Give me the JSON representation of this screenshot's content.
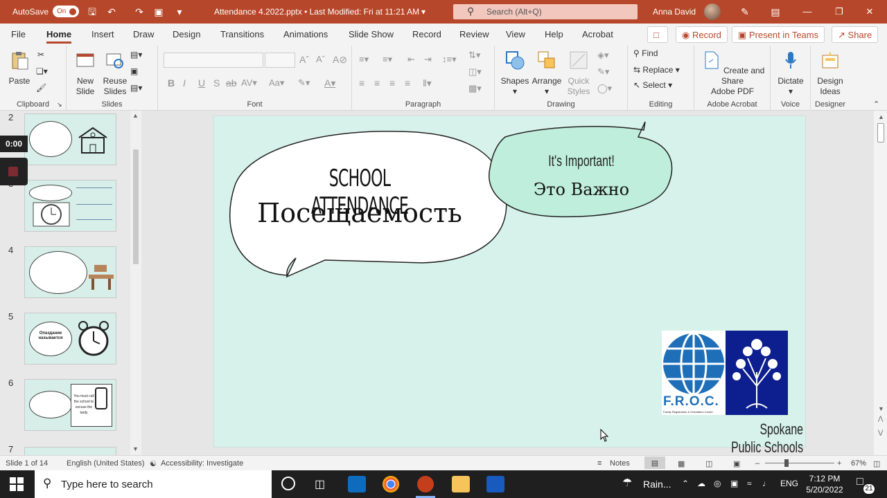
{
  "titlebar": {
    "autosave_label": "AutoSave",
    "autosave_state": "On",
    "doc_title": "Attendance 4.2022.pptx • Last Modified: Fri at 11:21 AM",
    "search_placeholder": "Search (Alt+Q)",
    "user_name": "Anna David"
  },
  "tabs": [
    "File",
    "Home",
    "Insert",
    "Draw",
    "Design",
    "Transitions",
    "Animations",
    "Slide Show",
    "Record",
    "Review",
    "View",
    "Help",
    "Acrobat"
  ],
  "top_buttons": {
    "record": "Record",
    "present": "Present in Teams",
    "share": "Share"
  },
  "ribbon": {
    "clipboard": {
      "label": "Clipboard",
      "paste": "Paste"
    },
    "slides": {
      "label": "Slides",
      "new_slide": "New\nSlide",
      "reuse": "Reuse\nSlides",
      "new_slide_l1": "New",
      "new_slide_l2": "Slide",
      "reuse_l1": "Reuse",
      "reuse_l2": "Slides"
    },
    "font": {
      "label": "Font"
    },
    "paragraph": {
      "label": "Paragraph"
    },
    "drawing": {
      "label": "Drawing",
      "shapes": "Shapes",
      "arrange": "Arrange",
      "quick_l1": "Quick",
      "quick_l2": "Styles"
    },
    "editing": {
      "label": "Editing",
      "find": "Find",
      "replace": "Replace",
      "select": "Select"
    },
    "acrobat": {
      "label": "Adobe Acrobat",
      "l1": "Create and Share",
      "l2": "Adobe PDF"
    },
    "voice": {
      "label": "Voice",
      "dictate": "Dictate"
    },
    "designer": {
      "label": "Designer",
      "l1": "Design",
      "l2": "Ideas"
    }
  },
  "thumbnails": [
    {
      "num": "2"
    },
    {
      "num": "3"
    },
    {
      "num": "4"
    },
    {
      "num": "5",
      "text": "Опаздание называется"
    },
    {
      "num": "6",
      "text": "You must call the school to excuse the tardy"
    },
    {
      "num": "7"
    }
  ],
  "recording": {
    "timer": "0:00"
  },
  "slide": {
    "title_en": "SCHOOL ATTENDANCE",
    "title_ru": "Посещаемость",
    "bubble_en": "It's Important!",
    "bubble_ru": "Это Важно",
    "logo_text": "F.R.O.C.",
    "logo_sub": "Family Registration & Orientation Center",
    "footer": "Spokane Public Schools"
  },
  "status": {
    "slide_info": "Slide 1 of 14",
    "language": "English (United States)",
    "accessibility": "Accessibility: Investigate",
    "notes": "Notes",
    "zoom": "67%"
  },
  "taskbar": {
    "search_placeholder": "Type here to search",
    "weather": "Rain...",
    "lang": "ENG",
    "time": "7:12 PM",
    "date": "5/20/2022",
    "notif_count": "21"
  },
  "colors": {
    "accent": "#b7472a",
    "slide_bg": "#d7f2ea",
    "bubble_green": "#bfeedd"
  }
}
